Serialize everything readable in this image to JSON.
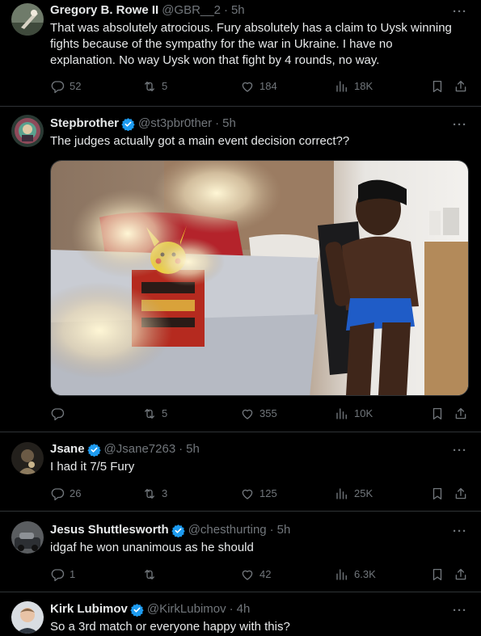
{
  "tweets": [
    {
      "name": "Gregory B. Rowe II",
      "handle": "@GBR__2",
      "time": "5h",
      "text_lines": [
        "That was absolutely atrocious. Fury absolutely has a claim to Uysk winning",
        "fights because of the sympathy for the war in Ukraine. I have no",
        "explanation. No way Uysk won that fight by 4 rounds, no way."
      ],
      "replies": "52",
      "retweets": "5",
      "likes": "184",
      "views": "18K"
    },
    {
      "name": "Stepbrother",
      "handle": "@st3pbr0ther",
      "time": "5h",
      "text_lines": [
        "The judges actually got a main event decision correct??"
      ],
      "replies": "",
      "retweets": "5",
      "likes": "355",
      "views": "10K"
    },
    {
      "name": "Jsane",
      "handle": "@Jsane7263",
      "time": "5h",
      "text_lines": [
        "I had it 7/5 Fury"
      ],
      "replies": "26",
      "retweets": "3",
      "likes": "125",
      "views": "25K"
    },
    {
      "name": "Jesus Shuttlesworth",
      "handle": "@chesthurting",
      "time": "5h",
      "text_lines": [
        "idgaf he won unanimous as he should"
      ],
      "replies": "1",
      "retweets": "",
      "likes": "42",
      "views": "6.3K"
    },
    {
      "name": "Kirk Lubimov",
      "handle": "@KirkLubimov",
      "time": "4h",
      "text_lines": [
        "So a 3rd match or everyone happy with this?"
      ]
    }
  ],
  "more_symbol": "···",
  "dot": "·",
  "colors": {
    "background": "#000000",
    "text": "#e7e9ea",
    "secondary": "#71767b",
    "verified": "#1d9bf0",
    "divider": "#2f3336"
  },
  "icons": [
    "reply-icon",
    "retweet-icon",
    "like-icon",
    "views-icon",
    "bookmark-icon",
    "share-icon",
    "verified-badge-icon",
    "more-icon"
  ]
}
